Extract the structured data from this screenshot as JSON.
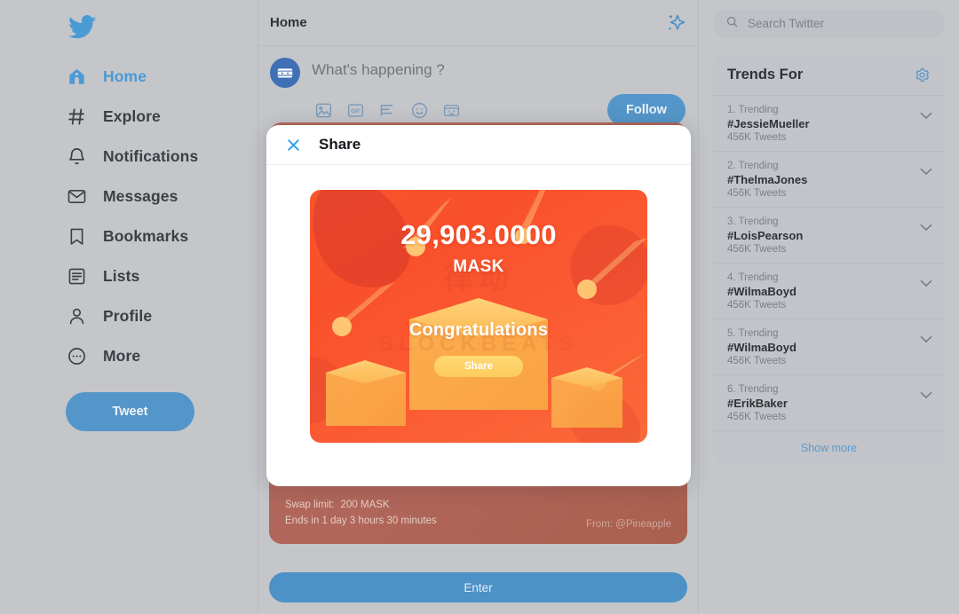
{
  "theme": {
    "page_background": "#c4c6ca",
    "accent_blue": "#5496c9",
    "link_blue": "#5a9ad2",
    "card_red": "#f9502b",
    "card_amber": "#fdcb5d",
    "promo_red": "#b0665a"
  },
  "sidebar": {
    "logo_icon": "twitter-bird-icon",
    "items": [
      {
        "label": "Home",
        "icon": "home-icon",
        "active": true
      },
      {
        "label": "Explore",
        "icon": "hashtag-icon",
        "active": false
      },
      {
        "label": "Notifications",
        "icon": "bell-icon",
        "active": false
      },
      {
        "label": "Messages",
        "icon": "envelope-icon",
        "active": false
      },
      {
        "label": "Bookmarks",
        "icon": "bookmark-icon",
        "active": false
      },
      {
        "label": "Lists",
        "icon": "list-icon",
        "active": false
      },
      {
        "label": "Profile",
        "icon": "person-icon",
        "active": false
      },
      {
        "label": "More",
        "icon": "more-circle-icon",
        "active": false
      }
    ],
    "tweet_button": "Tweet"
  },
  "feed": {
    "header_title": "Home",
    "sparkle_icon": "sparkle-icon",
    "compose": {
      "avatar_icon": "mask-avatar-icon",
      "placeholder": "What's happening ?",
      "icons": [
        "image-icon",
        "gif-icon",
        "poll-icon",
        "emoji-icon",
        "sticker-icon"
      ],
      "follow_button": "Follow"
    },
    "promo": {
      "swap_limit_label": "Swap limit:",
      "swap_limit_value": "200 MASK",
      "ends_in": "Ends in 1 day 3 hours 30 minutes",
      "from": "From: @Pineapple",
      "enter_button": "Enter"
    }
  },
  "search": {
    "icon": "search-icon",
    "placeholder": "Search Twitter"
  },
  "trends": {
    "title": "Trends For",
    "settings_icon": "gear-icon",
    "chevron_icon": "chevron-down-icon",
    "items": [
      {
        "rank": "1. Trending",
        "name": "#JessieMueller",
        "count": "456K Tweets"
      },
      {
        "rank": "2. Trending",
        "name": "#ThelmaJones",
        "count": "456K Tweets"
      },
      {
        "rank": "3. Trending",
        "name": "#LoisPearson",
        "count": "456K Tweets"
      },
      {
        "rank": "4. Trending",
        "name": "#WilmaBoyd",
        "count": "456K Tweets"
      },
      {
        "rank": "5. Trending",
        "name": "#WilmaBoyd",
        "count": "456K Tweets"
      },
      {
        "rank": "6. Trending",
        "name": "#ErikBaker",
        "count": "456K Tweets"
      }
    ],
    "show_more": "Show more"
  },
  "modal": {
    "close_icon": "close-icon",
    "title": "Share",
    "card": {
      "amount": "29,903.0000",
      "symbol": "MASK",
      "congrats": "Congratulations",
      "share_button": "Share",
      "watermark_top": "律动",
      "watermark_bottom": "BLOCKBEATS"
    }
  }
}
